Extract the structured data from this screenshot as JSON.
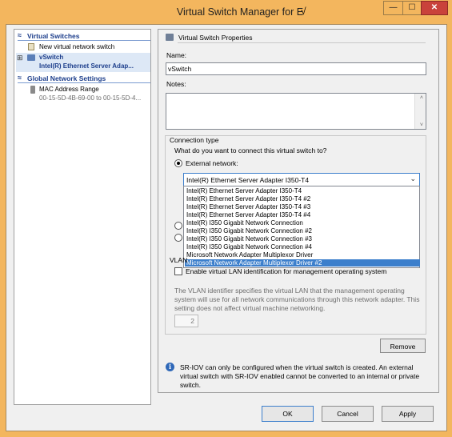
{
  "window": {
    "title": "Virtual Switch Manager for E",
    "title_mark": "√",
    "minimize_glyph": "—",
    "maximize_glyph": "☐",
    "close_glyph": "✕"
  },
  "sidebar": {
    "virtual_switches_header": "Virtual Switches",
    "new_switch_label": "New virtual network switch",
    "switch_name": "vSwitch",
    "switch_adapter": "Intel(R) Ethernet Server Adap...",
    "expand_glyph": "⊞",
    "collapse_glyph": "≈",
    "global_header": "Global Network Settings",
    "mac_range_label": "MAC Address Range",
    "mac_range_value": "00-15-5D-4B-69-00 to 00-15-5D-4..."
  },
  "properties": {
    "header": "Virtual Switch Properties",
    "name_label": "Name:",
    "name_value": "vSwitch",
    "notes_label": "Notes:",
    "connection_type_label": "Connection type",
    "connection_question": "What do you want to connect this virtual switch to?",
    "external_network_label": "External network:",
    "selected_adapter": "Intel(R) Ethernet Server Adapter I350-T4",
    "adapter_options": [
      "Intel(R) Ethernet Server Adapter I350-T4",
      "Intel(R) Ethernet Server Adapter I350-T4 #2",
      "Intel(R) Ethernet Server Adapter I350-T4 #3",
      "Intel(R) Ethernet Server Adapter I350-T4 #4",
      "Intel(R) I350 Gigabit Network Connection",
      "Intel(R) I350 Gigabit Network Connection #2",
      "Intel(R) I350 Gigabit Network Connection #3",
      "Intel(R) I350 Gigabit Network Connection #4",
      "Microsoft Network Adapter Multiplexor Driver",
      "Microsoft Network Adapter Multiplexor Driver #2"
    ],
    "highlighted_option": "Microsoft Network Adapter Multiplexor Driver #2",
    "vlan_label_partial": "VLAN",
    "vlan_checkbox_label": "Enable virtual LAN identification for management operating system",
    "vlan_description_1": "The VLAN identifier specifies the virtual LAN that the management operating",
    "vlan_description_2": "system will use for all network communications through this network adapter. This",
    "vlan_description_3": "setting does not affect virtual machine networking.",
    "vlan_id": "2",
    "remove_button": "Remove",
    "sriov_note_1": "SR-IOV can only be configured when the virtual switch is created. An external",
    "sriov_note_2": "virtual switch with SR-IOV enabled cannot be converted to an internal or private",
    "sriov_note_3": "switch.",
    "info_glyph": "i"
  },
  "footer": {
    "ok": "OK",
    "cancel": "Cancel",
    "apply": "Apply"
  },
  "colors": {
    "titlebar": "#f3b65e",
    "section_header": "#1e3f8c",
    "highlight": "#3c7fcc",
    "close_button": "#c9423b"
  }
}
